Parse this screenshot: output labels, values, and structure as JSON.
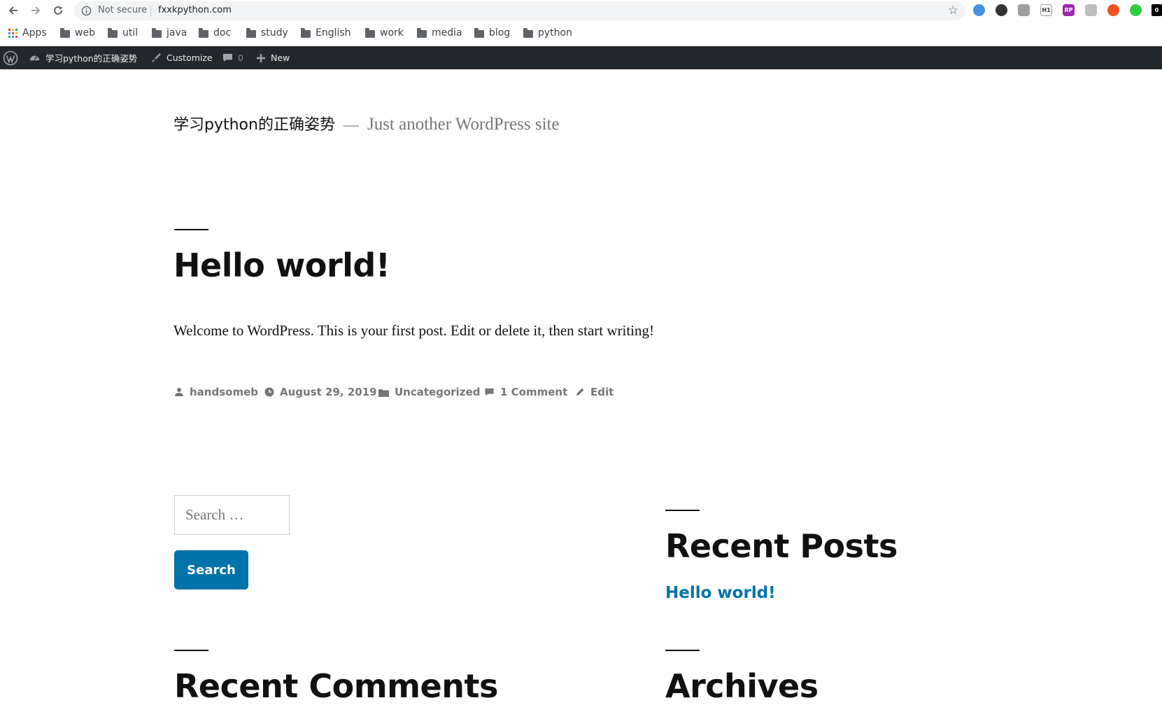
{
  "browser": {
    "security_label": "Not secure",
    "url": "fxxkpython.com",
    "extensions": [
      {
        "icon": "ext-blue-icon",
        "color": "#4a90e2",
        "text": ""
      },
      {
        "icon": "ext-halfmoon-icon",
        "color": "#333333",
        "text": ""
      },
      {
        "icon": "ext-shield-icon",
        "color": "#9e9e9e",
        "text": ""
      },
      {
        "icon": "ext-h1-icon",
        "color": "#ffffff",
        "text": "H1"
      },
      {
        "icon": "ext-purple-icon",
        "color": "#9c27b0",
        "text": "RP"
      },
      {
        "icon": "ext-grey-icon",
        "color": "#bdbdbd",
        "text": ""
      },
      {
        "icon": "ext-orange-icon",
        "color": "#f4511e",
        "text": ""
      },
      {
        "icon": "ext-green-icon",
        "color": "#2ecc40",
        "text": ""
      },
      {
        "icon": "ext-black-icon",
        "color": "#000000",
        "text": "0"
      }
    ]
  },
  "bookmarks": {
    "apps_label": "Apps",
    "folders": [
      "web",
      "util",
      "java",
      "doc",
      "study",
      "English",
      "work",
      "media",
      "blog",
      "python"
    ]
  },
  "adminbar": {
    "site_name": "学习python的正确姿势",
    "customize_label": "Customize",
    "comments_count": "0",
    "new_label": "New"
  },
  "site": {
    "title": "学习python的正确姿势",
    "dash": "—",
    "description": "Just another WordPress site"
  },
  "post": {
    "title": "Hello world!",
    "body": "Welcome to WordPress. This is your first post. Edit or delete it, then start writing!",
    "meta": {
      "author": "handsomeb",
      "date": "August 29, 2019",
      "category": "Uncategorized",
      "comments": "1 Comment",
      "edit": "Edit"
    }
  },
  "search": {
    "placeholder": "Search …",
    "button_label": "Search"
  },
  "widgets": {
    "recent_posts_title": "Recent Posts",
    "recent_posts": [
      "Hello world!"
    ],
    "recent_comments_title": "Recent Comments",
    "archives_title": "Archives"
  },
  "colors": {
    "adminbar_bg": "#23282d",
    "link_blue": "#0073aa",
    "meta_grey": "#767676"
  }
}
